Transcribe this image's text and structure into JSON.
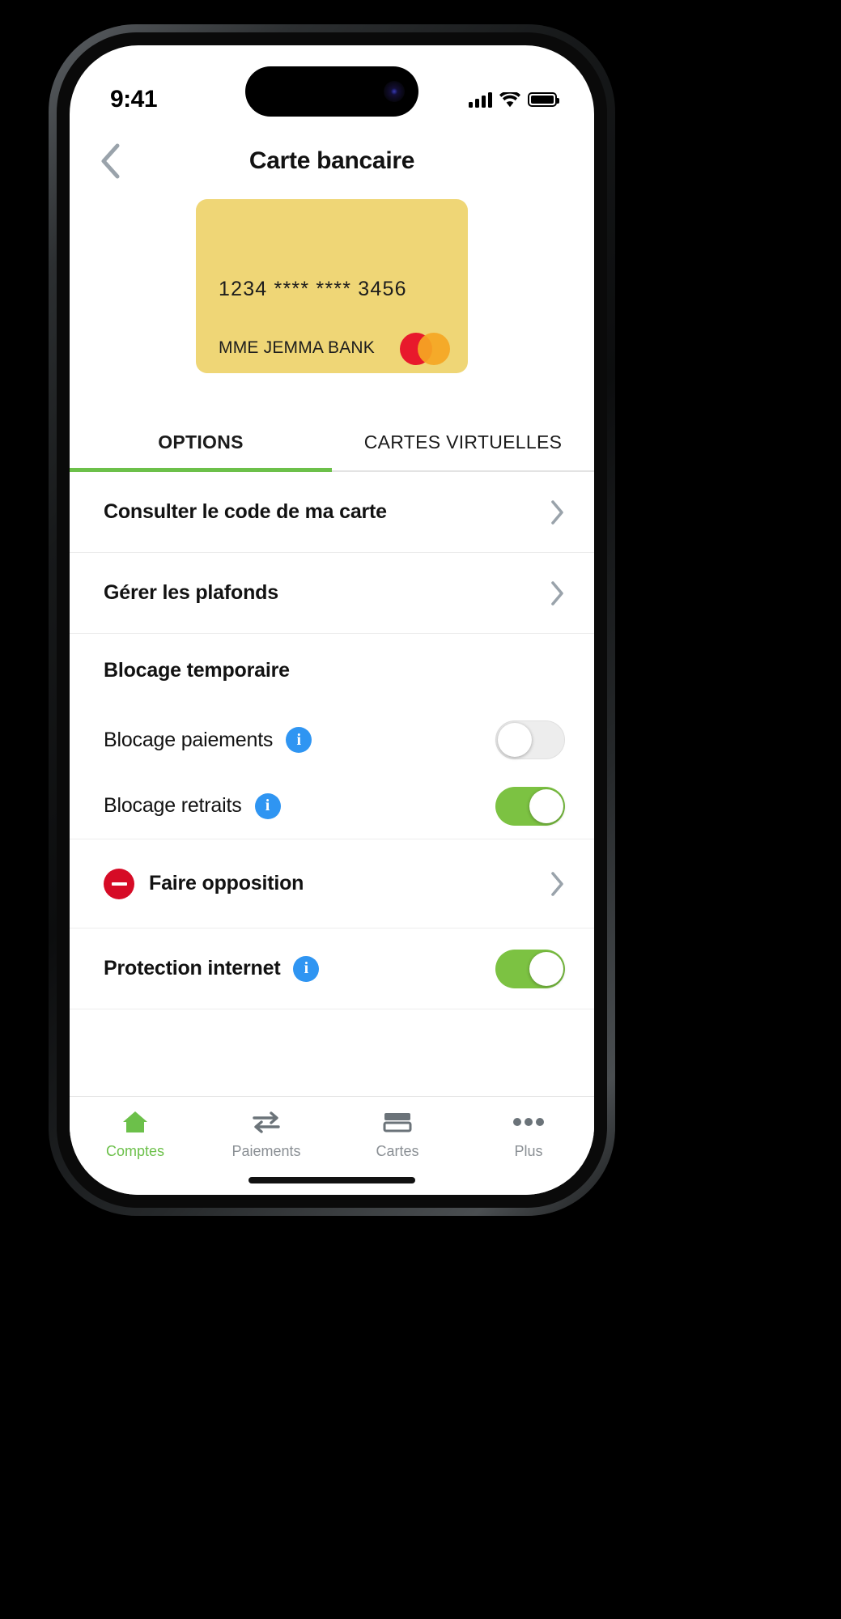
{
  "status_bar": {
    "time": "9:41",
    "signal_icon": "cellular-bars-icon",
    "wifi_icon": "wifi-icon",
    "battery_icon": "battery-full-icon"
  },
  "header": {
    "back_icon": "chevron-left-icon",
    "title": "Carte bancaire"
  },
  "card": {
    "number": "1234 **** **** 3456",
    "holder": "MME JEMMA BANK",
    "network_logo": "mastercard-logo",
    "background_color": "#EFD676",
    "logo_red": "#E8192C",
    "logo_orange": "#F5A623"
  },
  "tabs": {
    "items": [
      {
        "label": "OPTIONS",
        "active": true
      },
      {
        "label": "CARTES VIRTUELLES",
        "active": false
      }
    ],
    "indicator_color": "#6CC04A"
  },
  "options": {
    "consulter_code": "Consulter le code de ma carte",
    "gerer_plafonds": "Gérer les plafonds",
    "blocage_group_title": "Blocage temporaire",
    "blocage_paiements": "Blocage paiements",
    "blocage_paiements_state": "off",
    "blocage_retraits": "Blocage retraits",
    "blocage_retraits_state": "on",
    "faire_opposition": "Faire opposition",
    "protection_internet": "Protection internet",
    "protection_internet_state": "on",
    "info_icon": "info-circle-icon",
    "chevron_icon": "chevron-right-icon",
    "stop_icon": "stop-sign-icon",
    "toggle_on_color": "#7CC242",
    "info_color": "#2F95F2",
    "stop_color": "#D60B26"
  },
  "tabbar": {
    "items": [
      {
        "label": "Comptes",
        "icon": "home-icon",
        "active": true
      },
      {
        "label": "Paiements",
        "icon": "transfer-icon",
        "active": false
      },
      {
        "label": "Cartes",
        "icon": "card-icon",
        "active": false
      },
      {
        "label": "Plus",
        "icon": "more-dots-icon",
        "active": false
      }
    ],
    "active_color": "#6CC04A",
    "inactive_color": "#8a8f94"
  }
}
